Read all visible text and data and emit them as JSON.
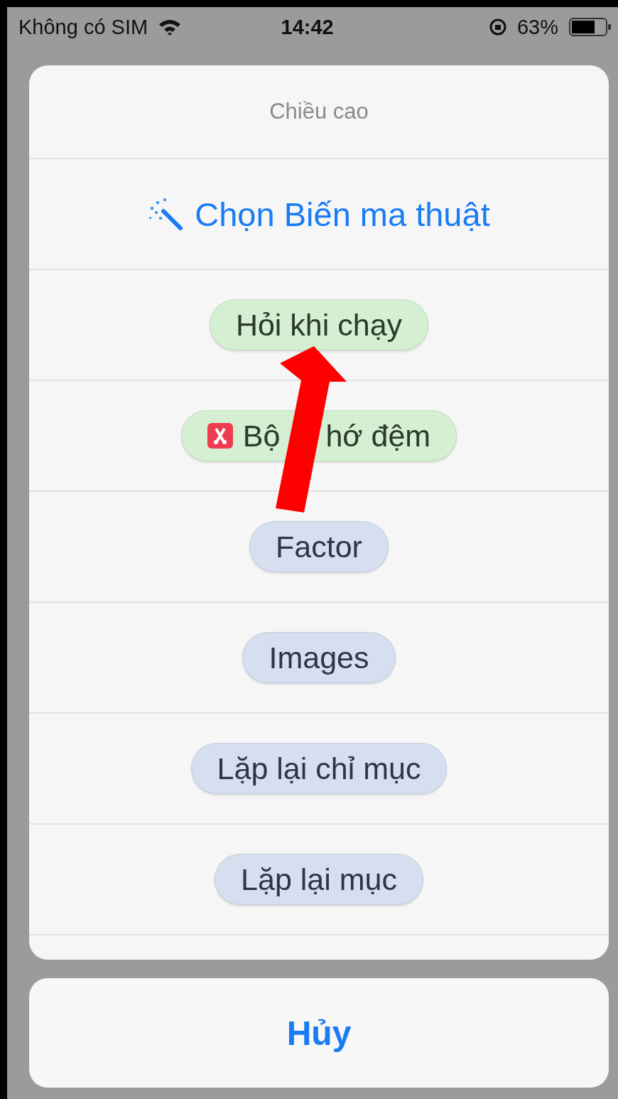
{
  "status_bar": {
    "carrier": "Không có SIM",
    "time": "14:42",
    "battery": "63%"
  },
  "sheet": {
    "title": "Chiều cao",
    "magic_action": "Chọn Biến ma thuật",
    "variables": [
      {
        "label": "Hỏi khi chạy",
        "color": "#d4efd2",
        "icon": false
      },
      {
        "label": "Bộ",
        "label_after_arrow": "hớ đệm",
        "color": "#d4efd2",
        "icon": true
      },
      {
        "label": "Factor",
        "color": "#d5dff0",
        "icon": false
      },
      {
        "label": "Images",
        "color": "#d5dff0",
        "icon": false
      },
      {
        "label": "Lặp lại chỉ mục",
        "color": "#d5dff0",
        "icon": false
      },
      {
        "label": "Lặp lại mục",
        "color": "#d5dff0",
        "icon": false
      }
    ]
  },
  "cancel": "Hủy"
}
